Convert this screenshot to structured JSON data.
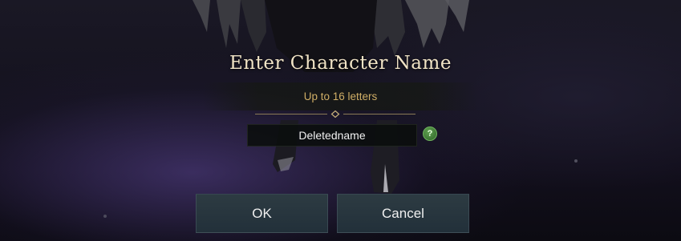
{
  "dialog": {
    "title": "Enter Character Name",
    "hint": "Up to 16 letters",
    "name_value": "Deletedname",
    "help_label": "?",
    "ok_label": "OK",
    "cancel_label": "Cancel"
  },
  "colors": {
    "title": "#f1e4c6",
    "hint": "#cfae66",
    "button_bg": "#2a3840",
    "help_icon": "#4e9340"
  },
  "icons": {
    "help": "question-mark-icon",
    "divider": "diamond-ornament-icon"
  }
}
